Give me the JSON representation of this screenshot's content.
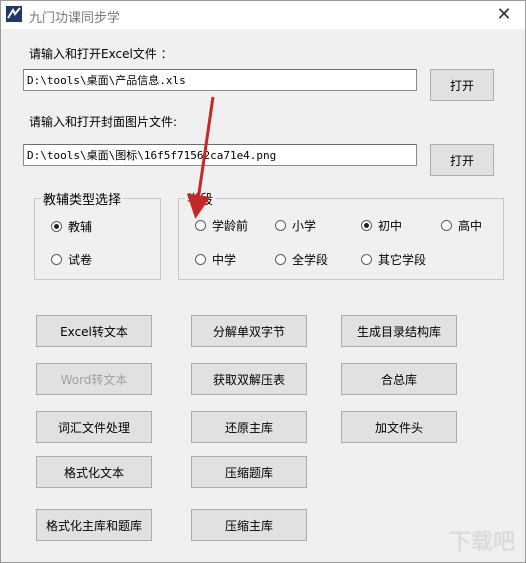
{
  "window": {
    "title": "九门功课同步学",
    "close_glyph": "✕"
  },
  "excel": {
    "label": "请输入和打开Excel文件 ：",
    "value": "D:\\tools\\桌面\\产品信息.xls",
    "open_button": "打开"
  },
  "cover": {
    "label": "请输入和打开封面图片文件:",
    "value": "D:\\tools\\桌面\\图标\\16f5f71562ca71e4.png",
    "open_button": "打开"
  },
  "type_group": {
    "title": "教辅类型选择",
    "options": [
      {
        "label": "教辅",
        "checked": true
      },
      {
        "label": "试卷",
        "checked": false
      }
    ]
  },
  "stage_group": {
    "title": "学段",
    "options": [
      {
        "label": "学龄前",
        "checked": false
      },
      {
        "label": "小学",
        "checked": false
      },
      {
        "label": "初中",
        "checked": true
      },
      {
        "label": "高中",
        "checked": false
      },
      {
        "label": "中学",
        "checked": false
      },
      {
        "label": "全学段",
        "checked": false
      },
      {
        "label": "其它学段",
        "checked": false
      }
    ]
  },
  "buttons": {
    "excel_to_text": "Excel转文本",
    "split_double_byte": "分解单双字节",
    "gen_catalog": "生成目录结构库",
    "word_to_text": "Word转文本",
    "get_double_table": "获取双解压表",
    "merge_lib": "合总库",
    "vocab_process": "词汇文件处理",
    "restore_main": "还原主库",
    "add_header": "加文件头",
    "format_text": "格式化文本",
    "compress_questions": "压缩题库",
    "format_main_and_questions": "格式化主库和题库",
    "compress_main": "压缩主库"
  },
  "watermark": {
    "text": "下载吧"
  },
  "colors": {
    "arrow": "#c62828",
    "window_bg": "#f0f0f0",
    "button_bg": "#e1e1e1"
  }
}
